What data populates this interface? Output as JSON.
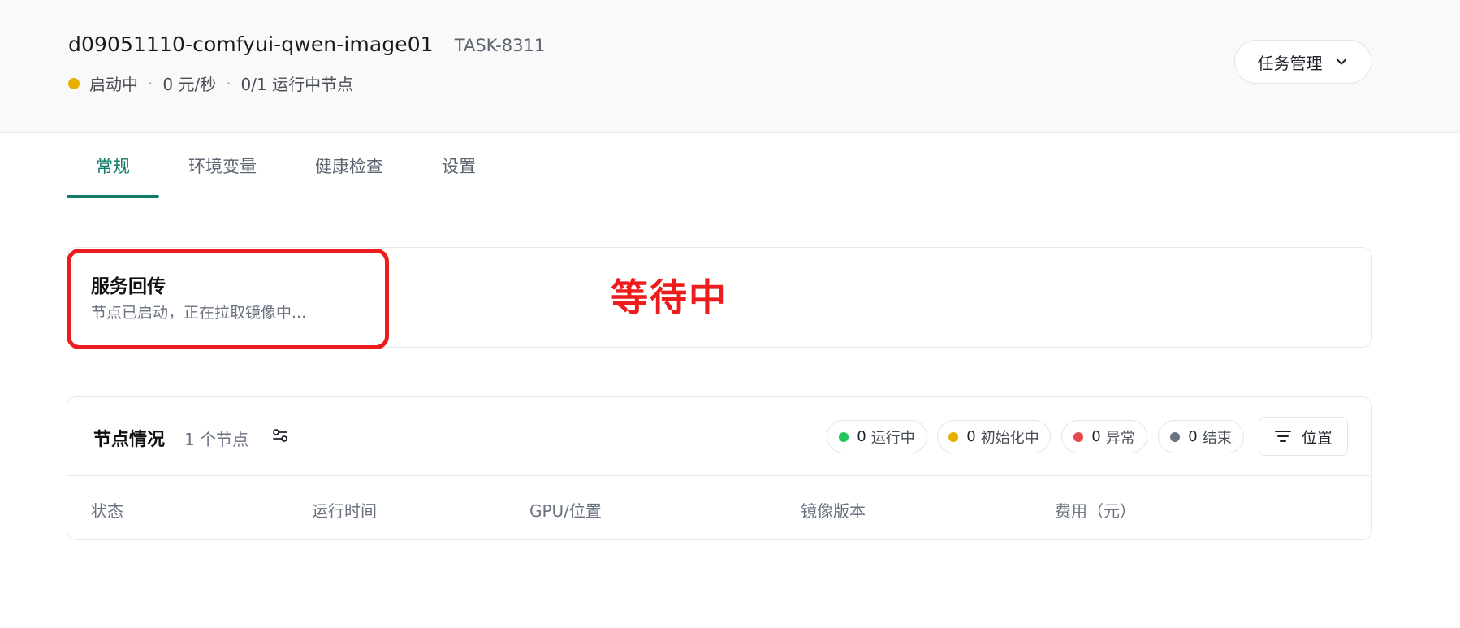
{
  "header": {
    "task_name": "d09051110-comfyui-qwen-image01",
    "task_id": "TASK-8311",
    "status": "启动中",
    "status_color": "#e6b000",
    "rate": "0 元/秒",
    "nodes_running": "0/1 运行中节点",
    "manage_button": "任务管理"
  },
  "tabs": [
    {
      "label": "常规",
      "active": true
    },
    {
      "label": "环境变量"
    },
    {
      "label": "健康检查"
    },
    {
      "label": "设置"
    }
  ],
  "service": {
    "title": "服务回传",
    "subtitle": "节点已启动，正在拉取镜像中...",
    "annotation": "等待中",
    "annotation_color": "#ee1c1c"
  },
  "nodes": {
    "title": "节点情况",
    "count": "1 个节点",
    "filters": [
      {
        "count": "0",
        "label": "运行中",
        "color": "#22c55e"
      },
      {
        "count": "0",
        "label": "初始化中",
        "color": "#e6b000"
      },
      {
        "count": "0",
        "label": "异常",
        "color": "#e5484d"
      },
      {
        "count": "0",
        "label": "结束",
        "color": "#6b7280"
      }
    ],
    "position_button": "位置",
    "columns": [
      "状态",
      "运行时间",
      "GPU/位置",
      "镜像版本",
      "费用（元）"
    ]
  },
  "accent_color": "#127a68"
}
